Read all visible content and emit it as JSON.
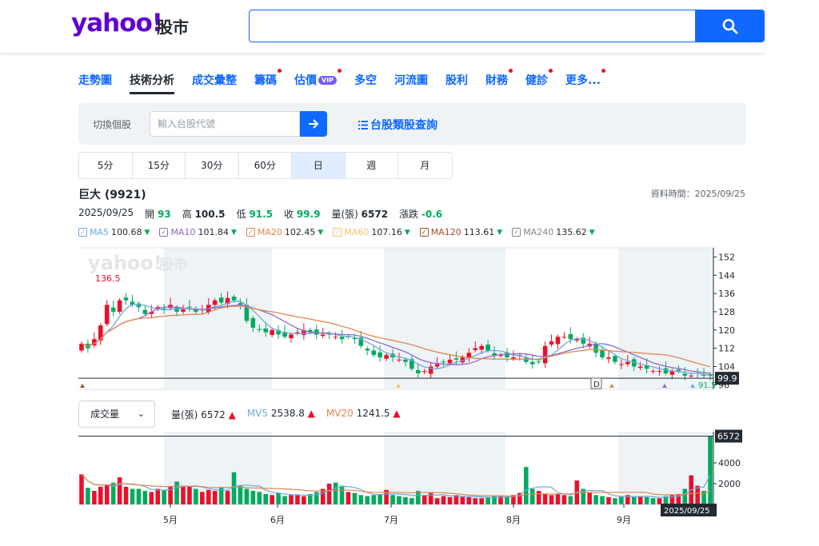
{
  "header": {
    "logo_text": "yahoo!",
    "logo_sub": "股市",
    "search_placeholder": ""
  },
  "tabs": [
    {
      "label": "走勢圖",
      "dot": false,
      "vip": false
    },
    {
      "label": "技術分析",
      "dot": false,
      "vip": false,
      "active": true
    },
    {
      "label": "成交彙整",
      "dot": false,
      "vip": false
    },
    {
      "label": "籌碼",
      "dot": true,
      "vip": false
    },
    {
      "label": "估價",
      "dot": true,
      "vip": true
    },
    {
      "label": "多空",
      "dot": false,
      "vip": false
    },
    {
      "label": "河流圖",
      "dot": false,
      "vip": false
    },
    {
      "label": "股利",
      "dot": false,
      "vip": false
    },
    {
      "label": "財務",
      "dot": true,
      "vip": false
    },
    {
      "label": "健診",
      "dot": true,
      "vip": false
    },
    {
      "label": "更多...",
      "dot": true,
      "vip": false
    }
  ],
  "vip_label": "VIP",
  "switcher": {
    "label": "切換個股",
    "placeholder": "輸入台股代號",
    "category_link": "台股類股查詢"
  },
  "periods": [
    {
      "label": "5分"
    },
    {
      "label": "15分"
    },
    {
      "label": "30分"
    },
    {
      "label": "60分"
    },
    {
      "label": "日",
      "active": true
    },
    {
      "label": "週"
    },
    {
      "label": "月"
    }
  ],
  "stock": {
    "title": "巨大 (9921)",
    "data_time": "資料時間：2025/09/25",
    "date": "2025/09/25",
    "open_label": "開",
    "open": "93",
    "high_label": "高",
    "high": "100.5",
    "low_label": "低",
    "low": "91.5",
    "close_label": "收",
    "close": "99.9",
    "volume_label": "量(張)",
    "volume": "6572",
    "change_label": "漲跌",
    "change": "-0.6"
  },
  "ma": [
    {
      "label": "MA5",
      "value": "100.68",
      "color": "#6fa8dc"
    },
    {
      "label": "MA10",
      "value": "101.84",
      "color": "#8e6bc9"
    },
    {
      "label": "MA20",
      "value": "102.45",
      "color": "#e08850"
    },
    {
      "label": "MA60",
      "value": "107.16",
      "color": "#f2c46d"
    },
    {
      "label": "MA120",
      "value": "113.61",
      "color": "#a0522d"
    },
    {
      "label": "MA240",
      "value": "135.62",
      "color": "#888888"
    }
  ],
  "volume_bar": {
    "select_label": "成交量",
    "vol_label": "量(張)",
    "vol_value": "6572",
    "mv5_label": "MV5",
    "mv5_value": "2538.8",
    "mv20_label": "MV20",
    "mv20_value": "1241.5"
  },
  "colors": {
    "up": "#eb0f29",
    "down": "#00ab5e",
    "accent": "#0f69ff",
    "brand": "#6001d2"
  },
  "chart_data": [
    {
      "type": "line",
      "title": "",
      "y_ticks": [
        152,
        144,
        136,
        128,
        120,
        112,
        104,
        96
      ],
      "ylim": [
        94,
        156
      ],
      "max_label": "136.5",
      "min_label": "91.5",
      "last_price_label": "99.9",
      "marker_label": "D",
      "close": [
        114,
        112,
        116,
        122,
        131,
        128,
        133,
        133,
        131,
        130,
        127,
        128,
        130,
        129,
        131,
        128,
        129,
        130,
        128,
        129,
        131,
        133,
        132,
        134,
        133,
        131,
        124,
        121,
        120,
        119,
        120,
        118,
        117,
        118,
        119,
        120,
        119,
        118,
        118,
        118,
        117,
        116,
        117,
        116,
        113,
        111,
        109,
        108,
        109,
        108,
        107,
        106,
        103,
        101,
        102,
        104,
        105,
        106,
        107,
        107,
        108,
        110,
        112,
        113,
        111,
        109,
        109,
        108,
        108,
        109,
        106,
        105,
        106,
        113,
        115,
        117,
        117,
        116,
        116,
        114,
        114,
        110,
        108,
        108,
        106,
        105,
        106,
        104,
        104,
        103,
        102,
        102,
        101,
        102,
        102,
        100,
        100,
        101,
        100,
        99.9
      ],
      "ma_series": [
        {
          "name": "MA5",
          "color": "#6fa8dc"
        },
        {
          "name": "MA10",
          "color": "#8e6bc9"
        },
        {
          "name": "MA20",
          "color": "#e08850"
        }
      ]
    },
    {
      "type": "bar",
      "title": "",
      "y_ticks": [
        2000,
        4000
      ],
      "ylim": [
        0,
        7000
      ],
      "last_volume_label": "6572",
      "date_label": "2025/09/25",
      "x_tick_labels": [
        "5月",
        "6月",
        "7月",
        "8月",
        "9月"
      ],
      "volumes": [
        2900,
        1600,
        1300,
        1700,
        1900,
        2100,
        2600,
        1700,
        1500,
        1500,
        1300,
        1200,
        1500,
        1400,
        1700,
        2200,
        1800,
        1700,
        1500,
        1200,
        1400,
        1300,
        1600,
        1300,
        3100,
        1800,
        1500,
        1300,
        1200,
        1000,
        900,
        1100,
        800,
        900,
        900,
        800,
        1000,
        1200,
        1500,
        2000,
        2100,
        1800,
        1200,
        1100,
        900,
        800,
        900,
        1000,
        1400,
        900,
        800,
        700,
        600,
        1300,
        900,
        1100,
        600,
        800,
        700,
        900,
        800,
        700,
        600,
        600,
        700,
        800,
        800,
        700,
        900,
        1100,
        3600,
        1500,
        1300,
        1000,
        900,
        1000,
        900,
        800,
        2300,
        1500,
        1200,
        900,
        800,
        700,
        600,
        800,
        900,
        700,
        800,
        700,
        600,
        600,
        800,
        900,
        1000,
        1500,
        2800,
        1800,
        1300,
        6572
      ]
    }
  ]
}
